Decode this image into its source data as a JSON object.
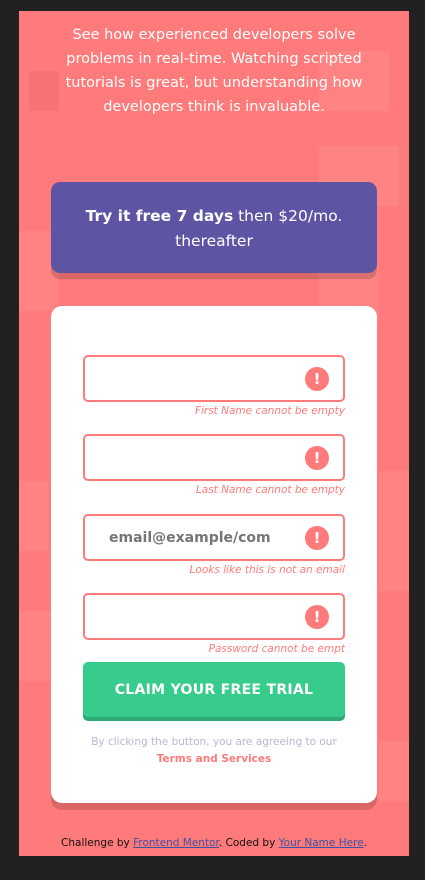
{
  "intro": {
    "text": "See how experienced developers solve problems in real-time. Watching scripted tutorials is great, but understanding how developers think is invaluable."
  },
  "promo": {
    "bold": "Try it free 7 days",
    "rest": " then $20/mo. thereafter"
  },
  "form": {
    "fields": [
      {
        "placeholder": "",
        "value": "",
        "error": "First Name cannot be empty"
      },
      {
        "placeholder": "",
        "value": "",
        "error": "Last Name cannot be empty"
      },
      {
        "placeholder": "email@example/com",
        "value": "",
        "error": "Looks like this is not an email"
      },
      {
        "placeholder": "",
        "value": "",
        "error": "Password cannot be empt"
      }
    ],
    "error_icon": "!",
    "submit_label": "CLAIM YOUR FREE TRIAL",
    "terms_prefix": "By clicking the button, you are agreeing to our",
    "terms_link": "Terms and Services"
  },
  "attribution": {
    "challenge_prefix": "Challenge by ",
    "challenge_link": "Frontend Mentor",
    "coded_prefix": ". Coded by ",
    "coded_link": "Your Name Here",
    "suffix": "."
  },
  "colors": {
    "background": "#ff7a7a",
    "promo": "#5e54a4",
    "cta": "#38cc8c",
    "error": "#ff7a7a",
    "frame": "#212121"
  },
  "icons": [
    "error-icon"
  ]
}
